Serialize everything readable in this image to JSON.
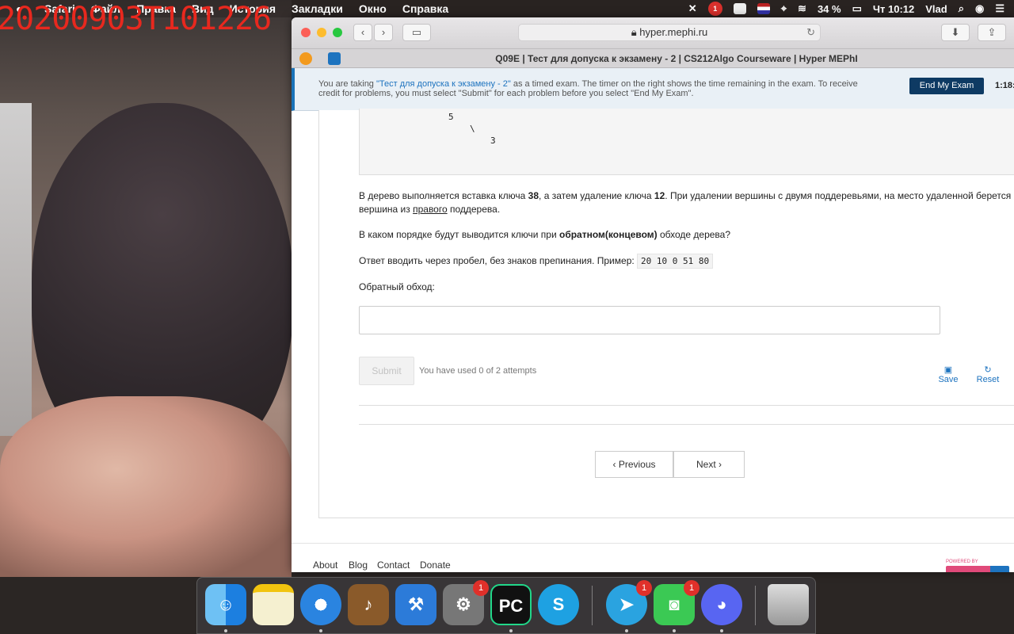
{
  "overlay": {
    "timestamp": "20200903T101226"
  },
  "menubar": {
    "apple": "",
    "items": [
      "Safari",
      "Файл",
      "Правка",
      "Вид",
      "История",
      "Закладки",
      "Окно",
      "Справка"
    ],
    "battery": "34 %",
    "clock": "Чт 10:12",
    "user": "Vlad",
    "notification_count": "1"
  },
  "browser": {
    "url": "hyper.mephi.ru",
    "tab_title": "Q09E | Тест для допуска к экзамену - 2 | CS212Algo Courseware | Hyper MEPhI",
    "back": "‹",
    "forward": "›"
  },
  "banner": {
    "msg_prefix": "You are taking ",
    "exam_link": "\"Тест для допуска к экзамену - 2\"",
    "msg_suffix": " as a timed exam. The timer on the right shows the time remaining in the exam. To receive credit for problems, you must select \"Submit\" for each problem before you select \"End My Exam\".",
    "end_button": "End My Exam",
    "timer": "1:18:"
  },
  "problem": {
    "tree_5": "5",
    "tree_slash": "\\",
    "tree_3": "3",
    "p1_a": "В дерево выполняется вставка ключа ",
    "p1_k1": "38",
    "p1_b": ", а затем удаление ключа ",
    "p1_k2": "12",
    "p1_c": ". При удалении вершины с двумя поддеревьями, на место удаленной берется вершина из ",
    "p1_u": "правого",
    "p1_d": " поддерева.",
    "p2_a": "В каком порядке будут выводится ключи при ",
    "p2_b": "обратном(концевом)",
    "p2_c": " обходе дерева?",
    "p3": "Ответ вводить через пробел, без знаков препинания. Пример: ",
    "example": "20 10 0 51 80",
    "label": "Обратный обход:",
    "answer_value": "",
    "submit": "Submit",
    "attempts": "You have used 0 of 2 attempts",
    "save": "Save",
    "reset": "Reset",
    "previous": "Previous",
    "next": "Next"
  },
  "footer": {
    "about": "About",
    "blog": "Blog",
    "contact": "Contact",
    "donate": "Donate",
    "powered": "POWERED BY"
  },
  "dock": {
    "apps": [
      "finder",
      "notes",
      "safari",
      "garageband",
      "xcode",
      "system-preferences",
      "pycharm",
      "skype",
      "telegram",
      "facetime",
      "discord",
      "trash"
    ],
    "sysprefs_badge": "1",
    "telegram_badge": "1",
    "facetime_badge": "1"
  },
  "colors": {
    "accent": "#1d73bf",
    "end_button": "#0e3a63",
    "timestamp": "#e8281e"
  }
}
